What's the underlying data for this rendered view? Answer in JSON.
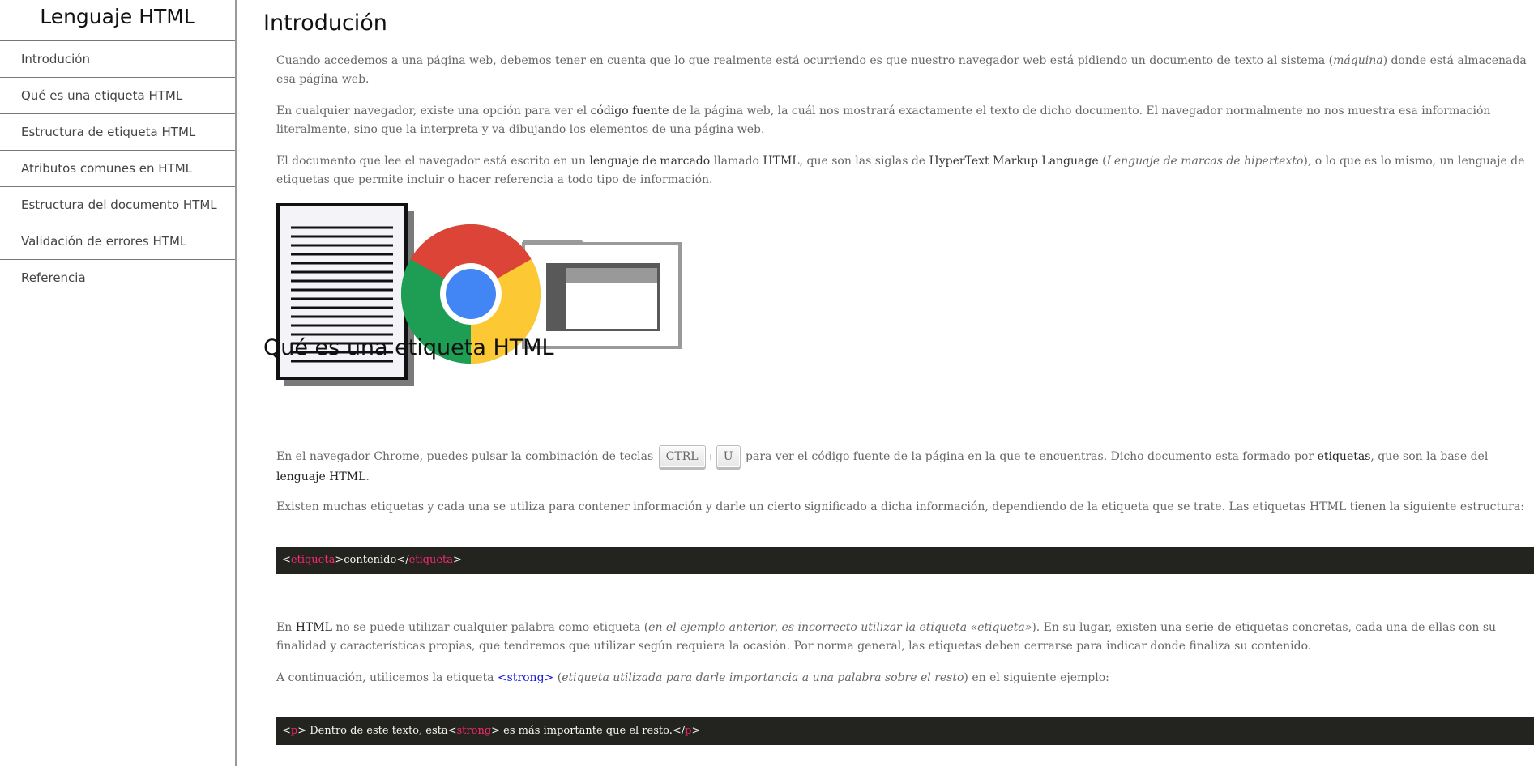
{
  "sidebar": {
    "title": "Lenguaje HTML",
    "items": [
      {
        "label": "Introdución"
      },
      {
        "label": "Qué es una etiqueta HTML"
      },
      {
        "label": "Estructura de etiqueta HTML"
      },
      {
        "label": "Atributos comunes en HTML"
      },
      {
        "label": "Estructura del documento HTML"
      },
      {
        "label": "Validación de errores HTML"
      },
      {
        "label": "Referencia"
      }
    ]
  },
  "intro": {
    "heading": "Introdución",
    "p1": {
      "a": "Cuando accedemos a una página web, debemos tener en cuenta que lo que realmente está ocurriendo es que nuestro navegador web está pidiendo un documento de texto al sistema (",
      "b": "máquina",
      "c": ") donde está almacenada esa página web."
    },
    "p2": {
      "a": "En cualquier navegador, existe una opción para ver el ",
      "b": "código fuente",
      "c": " de la página web, la cuál nos mostrará exactamente el texto de dicho documento. El navegador normalmente no nos muestra esa información literalmente, sino que la interpreta y va dibujando los elementos de una página web."
    },
    "p3": {
      "a": "El documento que lee el navegador está escrito en un ",
      "b": "lenguaje de marcado",
      "c": " llamado ",
      "d": "HTML",
      "e": ", que son las siglas de ",
      "f": "HyperText Markup Language",
      "g": " (",
      "h": "Lenguaje de marcas de hipertexto",
      "i": "), o lo que es lo mismo, un lenguaje de etiquetas que permite incluir o hacer referencia a todo tipo de información."
    }
  },
  "section2": {
    "heading": "Qué es una etiqueta HTML",
    "p1": {
      "a": "En el navegador Chrome, puedes pulsar la combinación de teclas ",
      "key1": "CTRL",
      "plus": "+",
      "key2": "U",
      "b": " para ver el código fuente de la página en la que te encuentras. Dicho documento esta formado por ",
      "c": "etiquetas",
      "d": ", que son la base del ",
      "e": "lenguaje HTML",
      "f": "."
    },
    "p2": "Existen muchas etiquetas y cada una se utiliza para contener información y darle un cierto significado a dicha información, dependiendo de la etiqueta que se trate. Las etiquetas HTML tienen la siguiente estructura:",
    "code1": {
      "lt1": "<",
      "tag1": "etiqueta",
      "mid": ">contenido</",
      "tag2": "etiqueta",
      "gt": ">"
    },
    "p3": {
      "a": "En ",
      "b": "HTML",
      "c": " no se puede utilizar cualquier palabra como etiqueta (",
      "d": "en el ejemplo anterior, es incorrecto utilizar la etiqueta «etiqueta»",
      "e": "). En su lugar, existen una serie de etiquetas concretas, cada una de ellas con su finalidad y características propias, que tendremos que utilizar según requiera la ocasión. Por norma general, las etiquetas deben cerrarse para indicar donde finaliza su contenido."
    },
    "p4": {
      "a": "A continuación, utilicemos la etiqueta ",
      "b": "<strong>",
      "c": " (",
      "d": "etiqueta utilizada para darle importancia a una palabra sobre el resto",
      "e": ") en el siguiente ejemplo:"
    },
    "code2": {
      "lt1": "<",
      "tag1": "p",
      "t1": "> Dentro de este texto, esta<",
      "tag2": "strong",
      "t2": "> es más importante que el resto.</",
      "tag3": "p",
      "gt": ">"
    }
  }
}
